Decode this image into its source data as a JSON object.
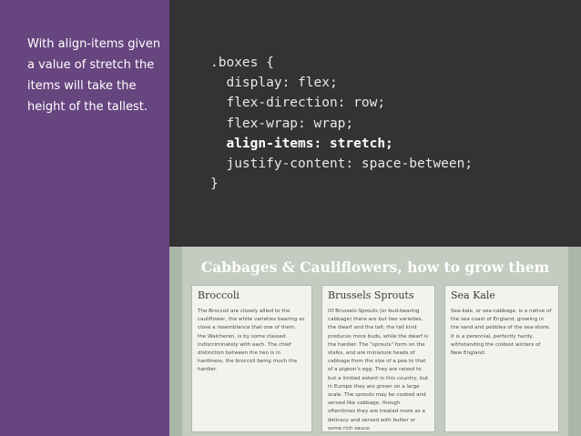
{
  "sidebar": {
    "text": "With align-items given a value of stretch the items will take the height of the tallest."
  },
  "code": {
    "line1": ".boxes {",
    "line2": "  display: flex;",
    "line3": "  flex-direction: row;",
    "line4": "  flex-wrap: wrap;",
    "line5": "  align-items: stretch;",
    "line6": "  justify-content: space-between;",
    "line7": "}"
  },
  "preview": {
    "title": "Cabbages & Cauliflowers, how to grow them",
    "boxes": [
      {
        "heading": "Broccoli",
        "body": "The Broccoli are closely allied to the cauliflower, the white varieties bearing so close a resemblance that one of them, the Walcheren, is by some classed indiscriminately with each. The chief distinction between the two is in hardiness, the broccoli being much the hardier."
      },
      {
        "heading": "Brussels Sprouts",
        "body": "Of Brussels-Sprouts (or bud-bearing cabbage) there are but two varieties, the dwarf and the tall; the tall kind produces more buds, while the dwarf is the hardier. The \"sprouts\" form on the stalks, and are miniature heads of cabbage from the size of a pea to that of a pigeon's egg. They are raised to but a limited extent in this country, but in Europe they are grown on a large scale. The sprouts may be cooked and served like cabbage, though oftentimes they are treated more as a delicacy and served with butter or some rich sauce."
      },
      {
        "heading": "Sea Kale",
        "body": "Sea-kale, or sea-cabbage, is a native of the sea coast of England, growing in the sand and pebbles of the sea-shore. It is a perennial, perfectly hardy, withstanding the coldest winters of New England."
      }
    ]
  }
}
